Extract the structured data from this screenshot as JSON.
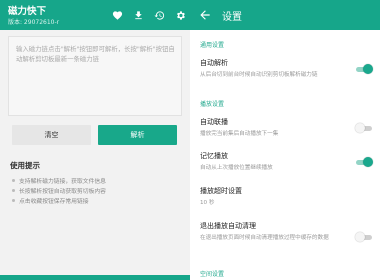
{
  "left": {
    "app": {
      "title": "磁力快下",
      "version": "版本: 29072610-r"
    },
    "input": {
      "placeholder": "输入磁力链点击\"解析\"按钮即可解析，长按\"解析\"按钮自动解析剪切板最新一条磁力链"
    },
    "buttons": {
      "clear": "清空",
      "parse": "解析"
    },
    "help": {
      "title": "使用提示",
      "items": [
        "支持解析磁力链接，获取文件信息",
        "长按解析按钮自动获取剪切板内容",
        "点击收藏按钮保存常用链接"
      ]
    }
  },
  "right": {
    "title": "设置",
    "sections": {
      "general": "通用设置",
      "playback": "播放设置",
      "space": "空间设置"
    },
    "items": {
      "auto_parse": {
        "title": "自动解析",
        "summary": "从后台切到前台时候自动识别剪切板解析磁力链",
        "on": true
      },
      "auto_play": {
        "title": "自动联播",
        "summary": "播放完当前集后自动播放下一集",
        "on": false
      },
      "remember": {
        "title": "记忆播放",
        "summary": "自动从上次播放位置继续播放",
        "on": true
      },
      "timeout": {
        "title": "播放超时设置",
        "summary": "10 秒"
      },
      "exit_clear": {
        "title": "退出播放自动清理",
        "summary": "在退出播放页面时候自动清理播放过程中缓存的数据",
        "on": false
      }
    }
  },
  "colors": {
    "accent": "#16a68a"
  }
}
